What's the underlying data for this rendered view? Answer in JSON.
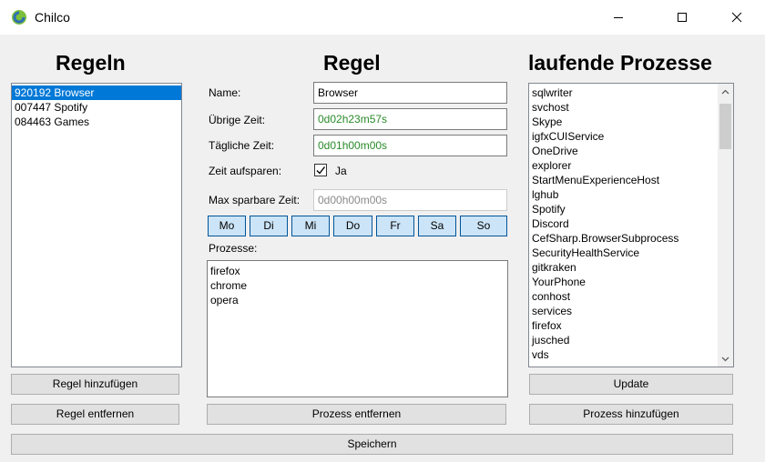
{
  "window": {
    "title": "Chilco"
  },
  "headings": {
    "rules": "Regeln",
    "rule": "Regel",
    "processes": "laufende Prozesse"
  },
  "rules": [
    {
      "label": "920192 Browser",
      "selected": true
    },
    {
      "label": "007447 Spotify",
      "selected": false
    },
    {
      "label": "084463 Games",
      "selected": false
    }
  ],
  "form": {
    "name_label": "Name:",
    "name_value": "Browser",
    "remaining_label": "Übrige Zeit:",
    "remaining_value": "0d02h23m57s",
    "daily_label": "Tägliche Zeit:",
    "daily_value": "0d01h00m00s",
    "save_time_label": "Zeit aufsparen:",
    "save_time_checked": true,
    "save_time_check_label": "Ja",
    "max_label": "Max sparbare Zeit:",
    "max_value": "0d00h00m00s",
    "days": [
      "Mo",
      "Di",
      "Mi",
      "Do",
      "Fr",
      "Sa",
      "So"
    ],
    "processes_label": "Prozesse:",
    "processes": [
      "firefox",
      "chrome",
      "opera"
    ]
  },
  "running_processes": [
    "sqlwriter",
    "svchost",
    "Skype",
    "igfxCUIService",
    "OneDrive",
    "explorer",
    "StartMenuExperienceHost",
    "lghub",
    "Spotify",
    "Discord",
    "CefSharp.BrowserSubprocess",
    "SecurityHealthService",
    "gitkraken",
    "YourPhone",
    "conhost",
    "services",
    "firefox",
    "jusched",
    "vds"
  ],
  "buttons": {
    "add_rule": "Regel hinzufügen",
    "remove_rule": "Regel entfernen",
    "remove_process": "Prozess entfernen",
    "update": "Update",
    "add_process": "Prozess hinzufügen",
    "save": "Speichern"
  },
  "icons": {
    "app": "chilco-logo-icon",
    "minimize": "minimize-icon",
    "maximize": "maximize-icon",
    "close": "close-icon"
  },
  "colors": {
    "selection": "#0078d7",
    "time_text": "#2a8a2a",
    "day_button": "#cce4f7"
  }
}
